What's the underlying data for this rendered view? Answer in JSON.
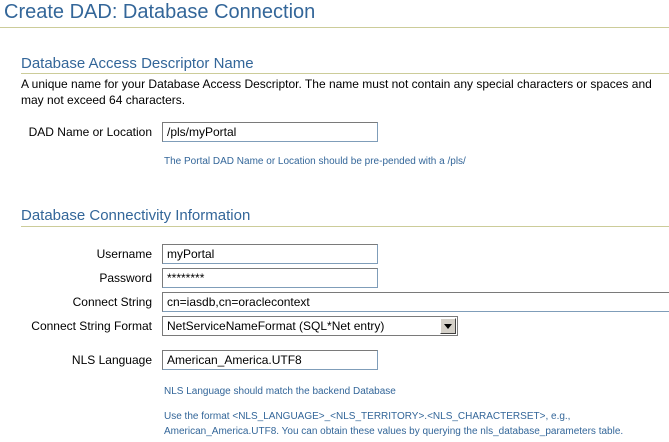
{
  "page": {
    "title": "Create DAD: Database Connection"
  },
  "dad_section": {
    "heading": "Database Access Descriptor Name",
    "description": "A unique name for your Database Access Descriptor. The name must not contain any special characters or spaces and may not exceed 64 characters.",
    "name_label": "DAD Name or Location",
    "name_value": "/pls/myPortal",
    "name_tip": "The Portal DAD Name or Location should be pre-pended with a /pls/"
  },
  "connectivity_section": {
    "heading": "Database Connectivity Information",
    "username_label": "Username",
    "username_value": "myPortal",
    "password_label": "Password",
    "password_value": "********",
    "connect_string_label": "Connect String",
    "connect_string_value": "cn=iasdb,cn=oraclecontext",
    "connect_format_label": "Connect String Format",
    "connect_format_value": "NetServiceNameFormat (SQL*Net entry)",
    "nls_label": "NLS Language",
    "nls_value": "American_America.UTF8",
    "nls_tip": "NLS Language should match the backend Database",
    "nls_format_tip_line1": "Use the format <NLS_LANGUAGE>_<NLS_TERRITORY>.<NLS_CHARACTERSET>, e.g.,",
    "nls_format_tip_line2": "American_America.UTF8. You can obtain these values by querying the nls_database_parameters table."
  },
  "colors": {
    "heading": "#336699",
    "rule": "#cccc99",
    "tip": "#336699"
  },
  "icons": {
    "dropdown": "chevron-down-icon"
  }
}
